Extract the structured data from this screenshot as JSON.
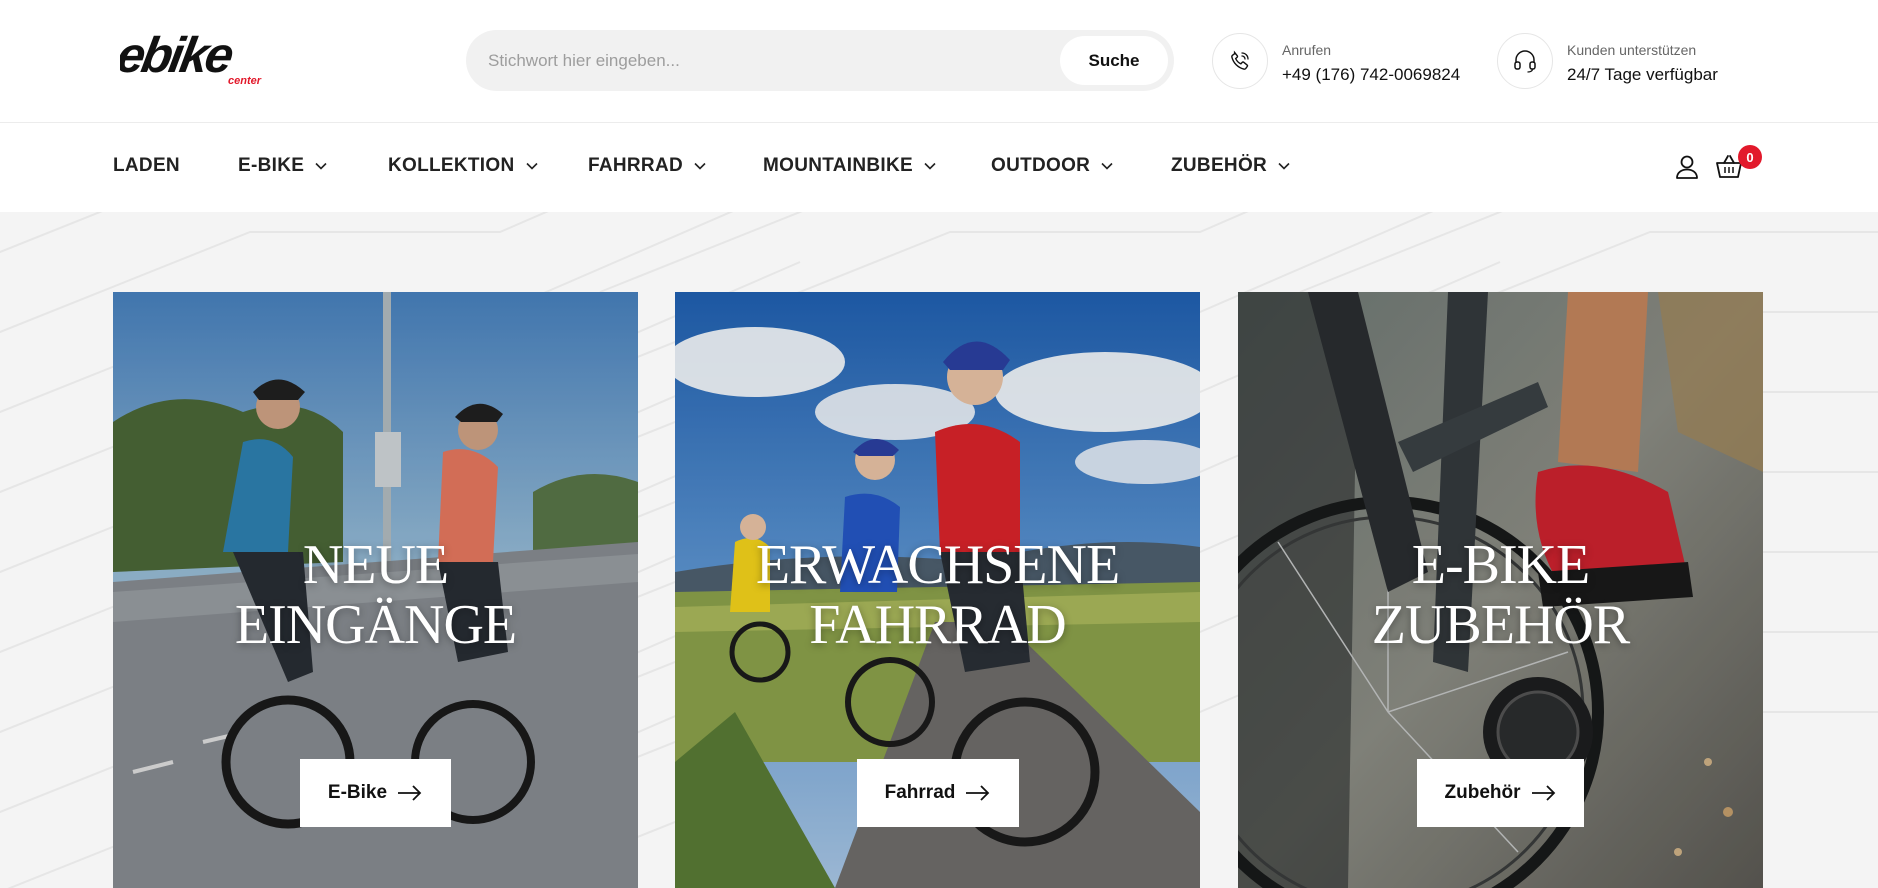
{
  "header": {
    "logo_text": "ebike",
    "logo_subtext": "center",
    "search": {
      "placeholder": "Stichwort hier eingeben...",
      "button_label": "Suche"
    },
    "call": {
      "label": "Anrufen",
      "value": "+49 (176) 742-0069824",
      "icon": "phone-icon"
    },
    "support": {
      "label": "Kunden unterstützen",
      "value": "24/7 Tage verfügbar",
      "icon": "headset-icon"
    }
  },
  "nav": {
    "items": [
      {
        "label": "LADEN",
        "dropdown": false
      },
      {
        "label": "E-BIKE",
        "dropdown": true
      },
      {
        "label": "KOLLEKTION",
        "dropdown": true
      },
      {
        "label": "FAHRRAD",
        "dropdown": true
      },
      {
        "label": "MOUNTAINBIKE",
        "dropdown": true
      },
      {
        "label": "OUTDOOR",
        "dropdown": true
      },
      {
        "label": "ZUBEHÖR",
        "dropdown": true
      }
    ],
    "account_icon": "user-icon",
    "cart_icon": "basket-icon",
    "cart_count": "0"
  },
  "cards": [
    {
      "title_line1": "NEUE",
      "title_line2": "EINGÄNGE",
      "button_label": "E-Bike",
      "button_icon": "arrow-right-icon"
    },
    {
      "title_line1": "ERWACHSENE",
      "title_line2": "FAHRRAD",
      "button_label": "Fahrrad",
      "button_icon": "arrow-right-icon"
    },
    {
      "title_line1": "E-BIKE",
      "title_line2": "ZUBEHÖR",
      "button_label": "Zubehör",
      "button_icon": "arrow-right-icon"
    }
  ],
  "colors": {
    "accent": "#e2192b",
    "text": "#111111",
    "hero_background": "#f4f4f4",
    "search_background": "#f1f1f1"
  }
}
